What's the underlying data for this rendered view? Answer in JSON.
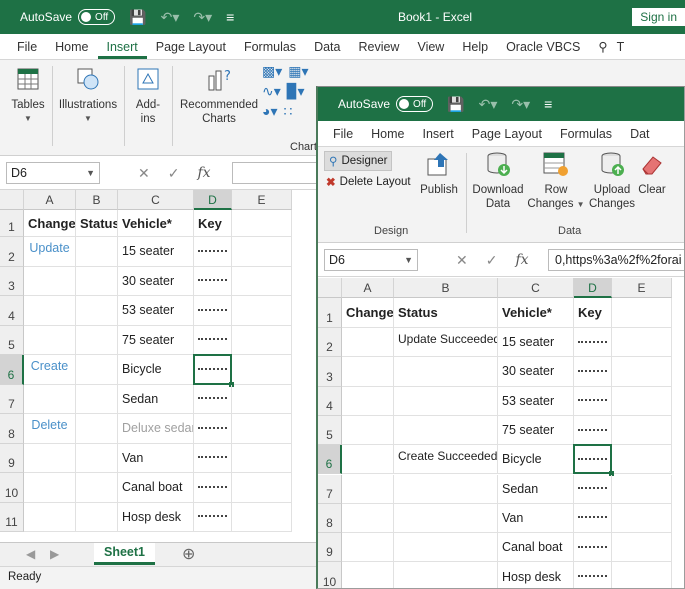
{
  "win1": {
    "autosave_label": "AutoSave",
    "autosave_state": "Off",
    "title": "Book1 - Excel",
    "signin": "Sign in",
    "tabs": [
      "File",
      "Home",
      "Insert",
      "Page Layout",
      "Formulas",
      "Data",
      "Review",
      "View",
      "Help",
      "Oracle VBCS"
    ],
    "active_tab": "Insert",
    "tell_me_cut": "T",
    "ribbon": {
      "tables": "Tables",
      "illustrations": "Illustrations",
      "addins_line1": "Add-",
      "addins_line2": "ins",
      "recommended_line1": "Recommended",
      "recommended_line2": "Charts",
      "charts_group_cut": "Chart"
    },
    "namebox": "D6",
    "columns": [
      "A",
      "B",
      "C",
      "D",
      "E"
    ],
    "rows": [
      "1",
      "2",
      "3",
      "4",
      "5",
      "6",
      "7",
      "8",
      "9",
      "10",
      "11"
    ],
    "headers": [
      "Change",
      "Status",
      "Vehicle*",
      "Key"
    ],
    "data": [
      {
        "change": "Update",
        "vehicle": "15 seater"
      },
      {
        "change": "",
        "vehicle": "30 seater"
      },
      {
        "change": "",
        "vehicle": "53 seater"
      },
      {
        "change": "",
        "vehicle": "75 seater"
      },
      {
        "change": "Create",
        "vehicle": "Bicycle"
      },
      {
        "change": "",
        "vehicle": "Sedan"
      },
      {
        "change": "Delete",
        "vehicle": "Deluxe sedan"
      },
      {
        "change": "",
        "vehicle": "Van"
      },
      {
        "change": "",
        "vehicle": "Canal boat"
      },
      {
        "change": "",
        "vehicle": "Hosp desk"
      }
    ],
    "sheet_tab": "Sheet1",
    "status": "Ready"
  },
  "win2": {
    "autosave_label": "AutoSave",
    "autosave_state": "Off",
    "tabs": [
      "File",
      "Home",
      "Insert",
      "Page Layout",
      "Formulas",
      "Dat"
    ],
    "ribbon": {
      "designer": "Designer",
      "delete_layout": "Delete Layout",
      "design_group": "Design",
      "publish": "Publish",
      "download_line1": "Download",
      "download_line2": "Data",
      "row_line1": "Row",
      "row_line2": "Changes",
      "upload_line1": "Upload",
      "upload_line2": "Changes",
      "clear": "Clear",
      "data_group": "Data"
    },
    "namebox": "D6",
    "formula": "0,https%3a%2f%2forai",
    "columns": [
      "A",
      "B",
      "C",
      "D",
      "E"
    ],
    "rows": [
      "1",
      "2",
      "3",
      "4",
      "5",
      "6",
      "7",
      "8",
      "9",
      "10"
    ],
    "headers": [
      "Change",
      "Status",
      "Vehicle*",
      "Key"
    ],
    "data": [
      {
        "status": "Update Succeeded",
        "vehicle": "15 seater"
      },
      {
        "status": "",
        "vehicle": "30 seater"
      },
      {
        "status": "",
        "vehicle": "53 seater"
      },
      {
        "status": "",
        "vehicle": "75 seater"
      },
      {
        "status": "Create Succeeded",
        "vehicle": "Bicycle"
      },
      {
        "status": "",
        "vehicle": "Sedan"
      },
      {
        "status": "",
        "vehicle": "Van"
      },
      {
        "status": "",
        "vehicle": "Canal boat"
      },
      {
        "status": "",
        "vehicle": "Hosp desk"
      }
    ]
  }
}
